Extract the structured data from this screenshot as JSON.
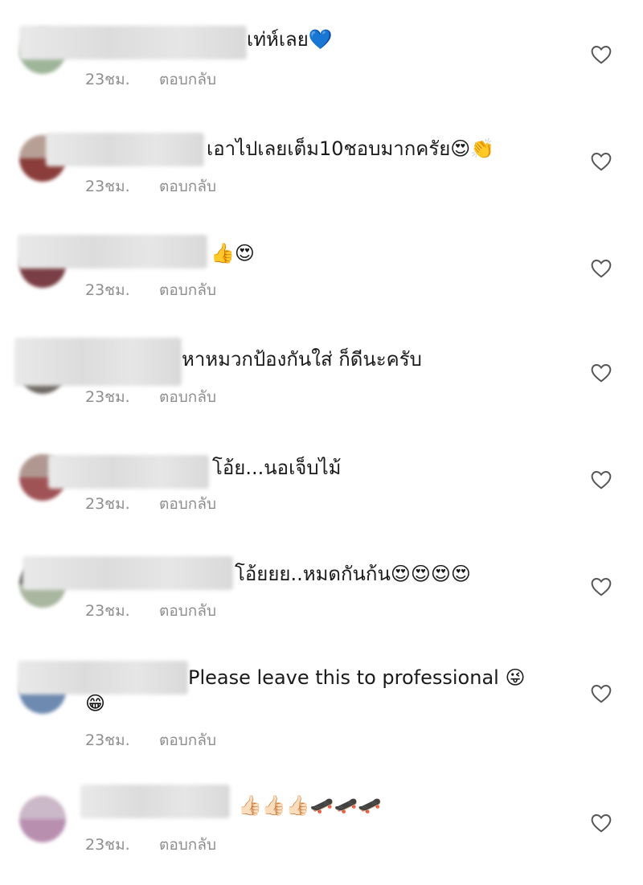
{
  "comments": [
    {
      "text": "เท่ห์เลย💙",
      "time": "23ชม.",
      "reply": "ตอบกลับ"
    },
    {
      "text": "เอาไปเลยเต็ม10ชอบมากครัย😍👏",
      "time": "23ชม.",
      "reply": "ตอบกลับ"
    },
    {
      "text": "👍😍",
      "time": "23ชม.",
      "reply": "ตอบกลับ"
    },
    {
      "text": "หาหมวกป้องกันใส่ ก็ดีนะครับ",
      "time": "23ชม.",
      "reply": "ตอบกลับ"
    },
    {
      "text": "โอ้ย...นอเจ็บไม้",
      "time": "23ชม.",
      "reply": "ตอบกลับ"
    },
    {
      "text": "โอ้ยยย..หมดกันก้น😍😍😍😍",
      "time": "23ชม.",
      "reply": "ตอบกลับ"
    },
    {
      "text": "Please leave this to professional 😜",
      "text_line2": "😁",
      "time": "23ชม.",
      "reply": "ตอบกลับ"
    },
    {
      "text": "👍🏻👍🏻👍🏻🛹🛹🛹",
      "time": "23ชม.",
      "reply": "ตอบกลับ"
    }
  ],
  "icons": {
    "like": "heart-outline-icon"
  },
  "colors": {
    "meta_text": "#8e8e8e",
    "heart_stroke": "#555555"
  }
}
